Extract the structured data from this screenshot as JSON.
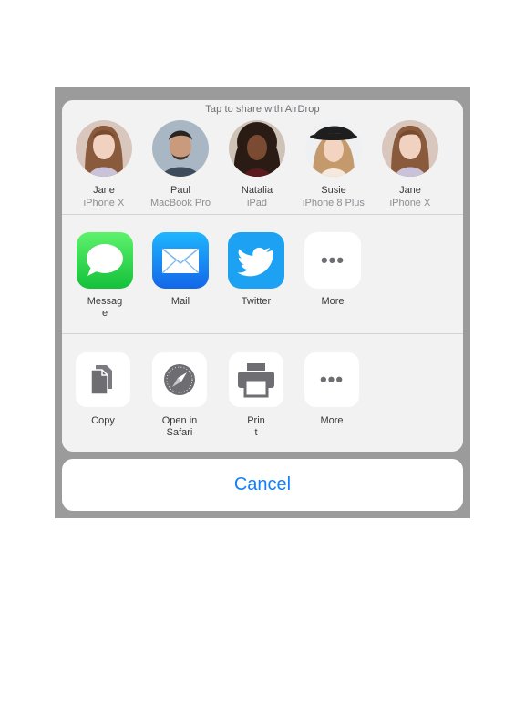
{
  "airdrop": {
    "title": "Tap to share with AirDrop",
    "contacts": [
      {
        "name": "Jane",
        "device": "iPhone X"
      },
      {
        "name": "Paul",
        "device": "MacBook Pro"
      },
      {
        "name": "Natalia",
        "device": "iPad"
      },
      {
        "name": "Susie",
        "device": "iPhone 8 Plus"
      },
      {
        "name": "Jane",
        "device": "iPhone X"
      }
    ]
  },
  "apps": [
    {
      "label": "Messag\ne",
      "icon": "messages-icon"
    },
    {
      "label": "Mail",
      "icon": "mail-icon"
    },
    {
      "label": "Twitter",
      "icon": "twitter-icon"
    },
    {
      "label": "More",
      "icon": "more-icon"
    }
  ],
  "actions": [
    {
      "label": "Copy",
      "icon": "copy-icon"
    },
    {
      "label": "Open in\nSafari",
      "icon": "safari-icon"
    },
    {
      "label": "Prin\nt",
      "icon": "print-icon"
    },
    {
      "label": "More",
      "icon": "more-icon"
    }
  ],
  "cancel_label": "Cancel",
  "colors": {
    "accent": "#147efb",
    "messages": "#2dd14a",
    "mail": "#1a8cf5",
    "twitter": "#1da1f2",
    "sheet": "#f2f2f2",
    "dim": "#9b9b9b"
  }
}
